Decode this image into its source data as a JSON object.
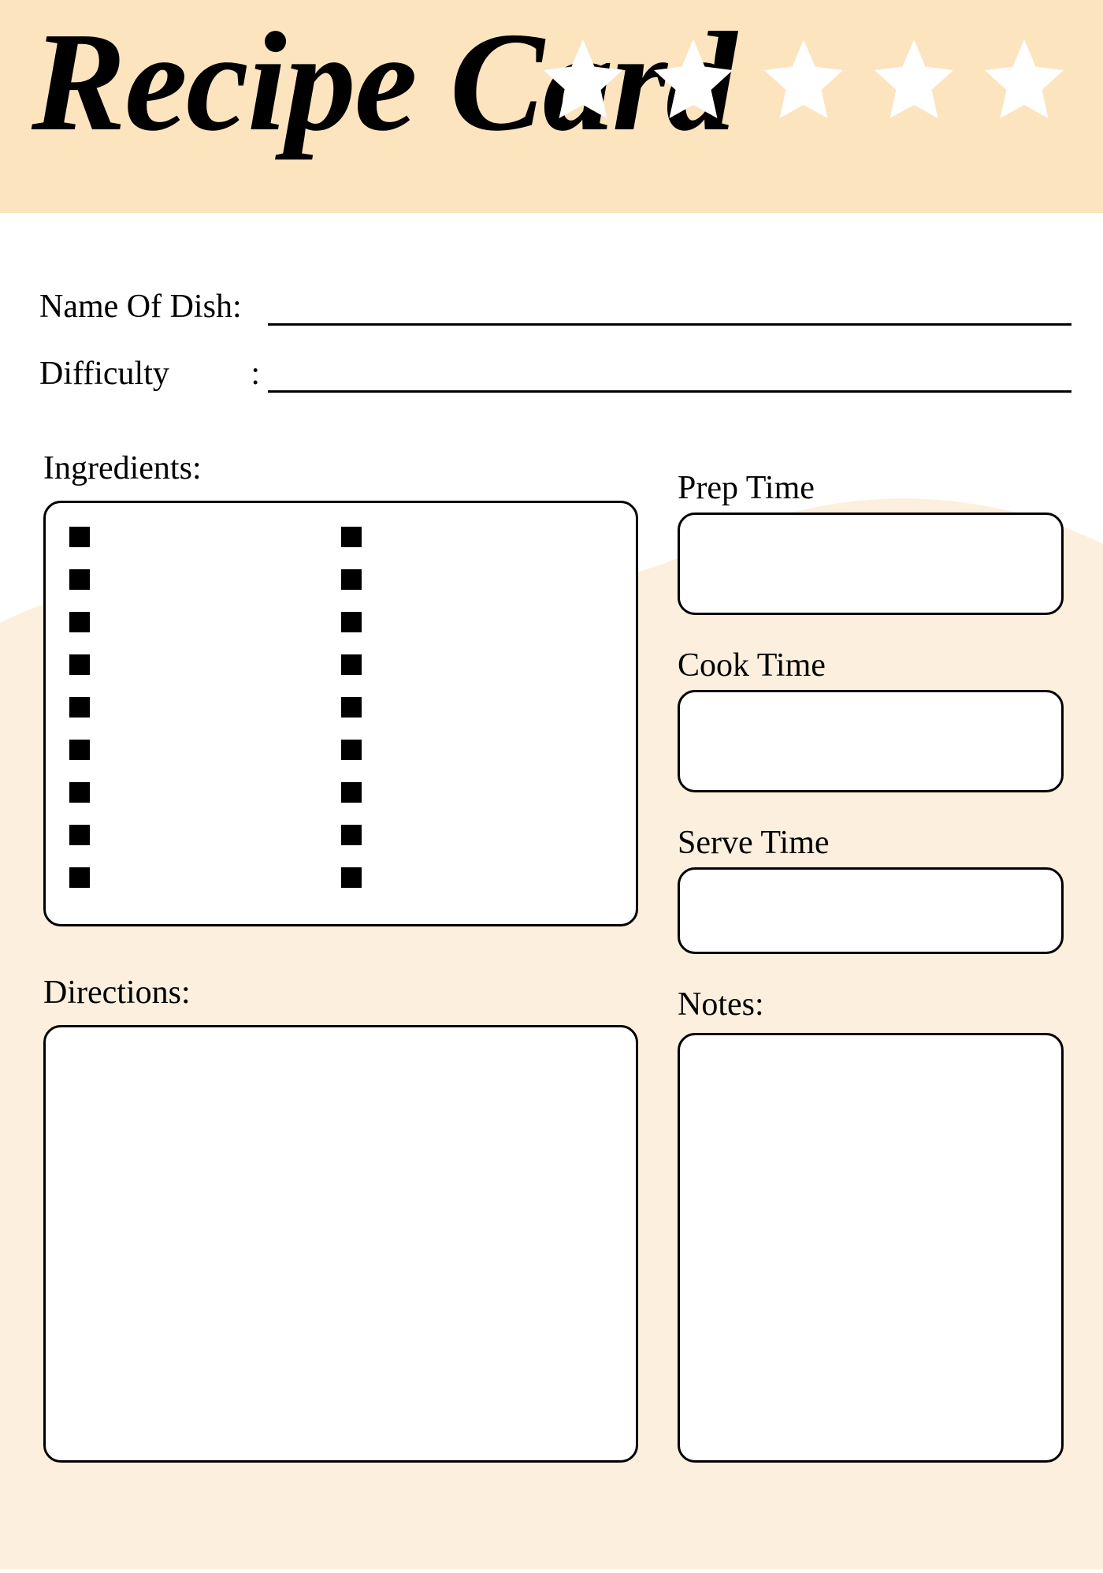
{
  "header": {
    "title": "Recipe Card",
    "stars_count": 5
  },
  "fields": {
    "name_label": "Name Of Dish:",
    "name_value": "",
    "difficulty_label": "Difficulty",
    "difficulty_colon": ":",
    "difficulty_value": ""
  },
  "sections": {
    "ingredients_label": "Ingredients:",
    "prep_label": "Prep Time",
    "prep_value": "",
    "cook_label": "Cook Time",
    "cook_value": "",
    "serve_label": "Serve Time",
    "serve_value": "",
    "directions_label": "Directions:",
    "directions_value": "",
    "notes_label": "Notes:",
    "notes_value": ""
  },
  "ingredients": {
    "bullets_per_column": 9,
    "columns": 2
  },
  "colors": {
    "header_band": "#fce4bf",
    "wave": "#fdefdd",
    "star_fill": "#ffffff"
  }
}
